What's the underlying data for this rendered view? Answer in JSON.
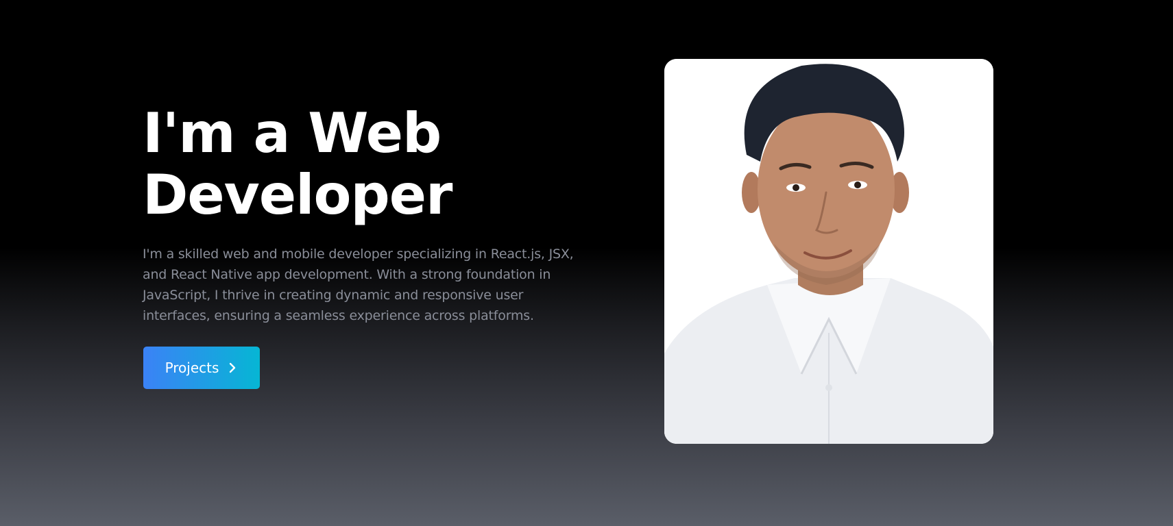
{
  "hero": {
    "headline_line1": "I'm a Web",
    "headline_line2": "Developer",
    "intro": "I'm a skilled web and mobile developer specializing in React.js, JSX, and React Native app development. With a strong foundation in JavaScript, I thrive in creating dynamic and responsive user interfaces, ensuring a seamless experience across platforms.",
    "cta_label": "Projects",
    "cta_icon": "chevron-right-icon"
  },
  "colors": {
    "background_top": "#000000",
    "background_bottom": "#5a5e68",
    "text_primary": "#ffffff",
    "text_muted": "#8a8e99",
    "cta_gradient_start": "#3b82f6",
    "cta_gradient_end": "#06b6d4"
  }
}
